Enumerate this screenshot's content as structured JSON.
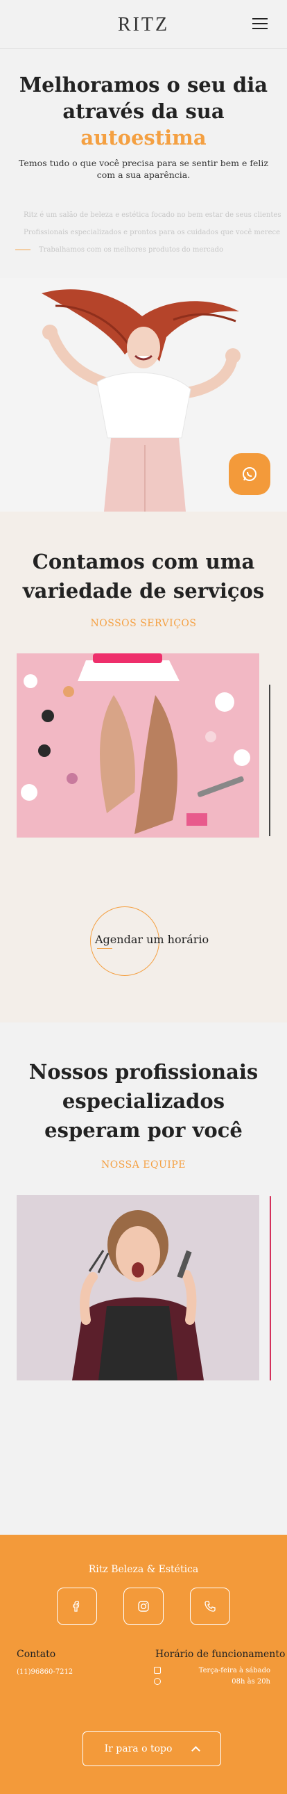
{
  "header": {
    "logo": "RITZ",
    "menu_icon": "hamburger-menu-icon"
  },
  "hero": {
    "title": "Melhoramos o seu dia através da sua",
    "title_accent": "autoestima",
    "subtitle": "Temos tudo o que você precisa para se sentir bem e feliz com a sua aparência.",
    "features": [
      "Ritz é um salão de beleza e estética focado no bem estar de seus clientes",
      "Profissionais especializados e prontos para os cuidados que você merece",
      "Trabalhamos com os melhores produtos do mercado"
    ],
    "whatsapp_icon": "whatsapp-icon"
  },
  "services": {
    "title": "Contamos com uma variedade de serviços",
    "subtitle": "NOSSOS SERVIÇOS",
    "schedule_label": "Agendar um horário"
  },
  "team": {
    "title": "Nossos profissionais especializados esperam por você",
    "subtitle": "NOSSA EQUIPE"
  },
  "footer": {
    "brand": "Ritz Beleza & Estética",
    "social_icons": [
      "facebook-icon",
      "instagram-icon",
      "phone-icon"
    ],
    "contact_heading": "Contato",
    "contact_phone": "(11)96860-7212",
    "hours_heading": "Horário de funcionamento",
    "hours_days": "Terça-feira à sábado",
    "hours_time": "08h às 20h",
    "back_to_top": "Ir para o topo"
  },
  "colors": {
    "accent": "#f39a3a",
    "team_edge": "#d4315b"
  }
}
